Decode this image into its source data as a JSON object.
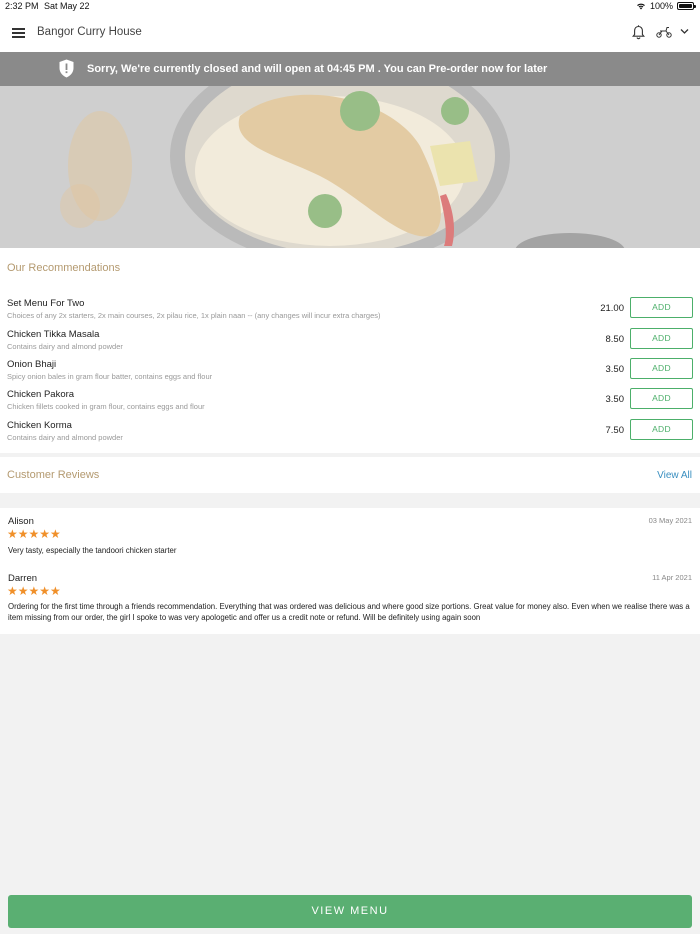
{
  "status_bar": {
    "time": "2:32 PM",
    "date": "Sat May 22",
    "battery": "100%"
  },
  "header": {
    "title": "Bangor Curry House"
  },
  "notice": {
    "text": "Sorry, We're currently closed and will open at 04:45 PM . You can Pre-order now for later"
  },
  "recommendations": {
    "title": "Our Recommendations",
    "add_label": "ADD",
    "items": [
      {
        "name": "Set Menu For Two",
        "description": "Choices of any 2x starters, 2x main courses, 2x pilau rice, 1x plain naan -- (any changes will incur extra charges)",
        "price": "21.00"
      },
      {
        "name": "Chicken Tikka Masala",
        "description": "Contains dairy and almond powder",
        "price": "8.50"
      },
      {
        "name": "Onion Bhaji",
        "description": "Spicy onion bales in gram flour batter, contains eggs and flour",
        "price": "3.50"
      },
      {
        "name": "Chicken Pakora",
        "description": "Chicken fillets cooked in gram flour, contains eggs and flour",
        "price": "3.50"
      },
      {
        "name": "Chicken Korma",
        "description": "Contains dairy and almond powder",
        "price": "7.50"
      }
    ]
  },
  "reviews": {
    "title": "Customer Reviews",
    "view_all": "View All",
    "items": [
      {
        "name": "Alison",
        "date": "03 May 2021",
        "stars": "★★★★★",
        "rating": 5,
        "text": "Very tasty, especially the tandoori chicken starter"
      },
      {
        "name": "Darren",
        "date": "11 Apr 2021",
        "stars": "★★★★★",
        "rating": 5,
        "text": "Ordering for the first time through a friends recommendation.  Everything that was ordered was delicious and where good size portions. Great value for money also.   Even when we realise there was a item missing from our order, the girl I spoke to was very apologetic and offer us a credit note or refund. Will be definitely using again soon"
      }
    ]
  },
  "footer": {
    "view_menu": "VIEW MENU"
  },
  "colors": {
    "accent_green": "#5aaf72",
    "section_title": "#b49a70",
    "link_blue": "#3a8fc0",
    "star_orange": "#f0902a",
    "notice_bg": "#8a8a8a"
  }
}
